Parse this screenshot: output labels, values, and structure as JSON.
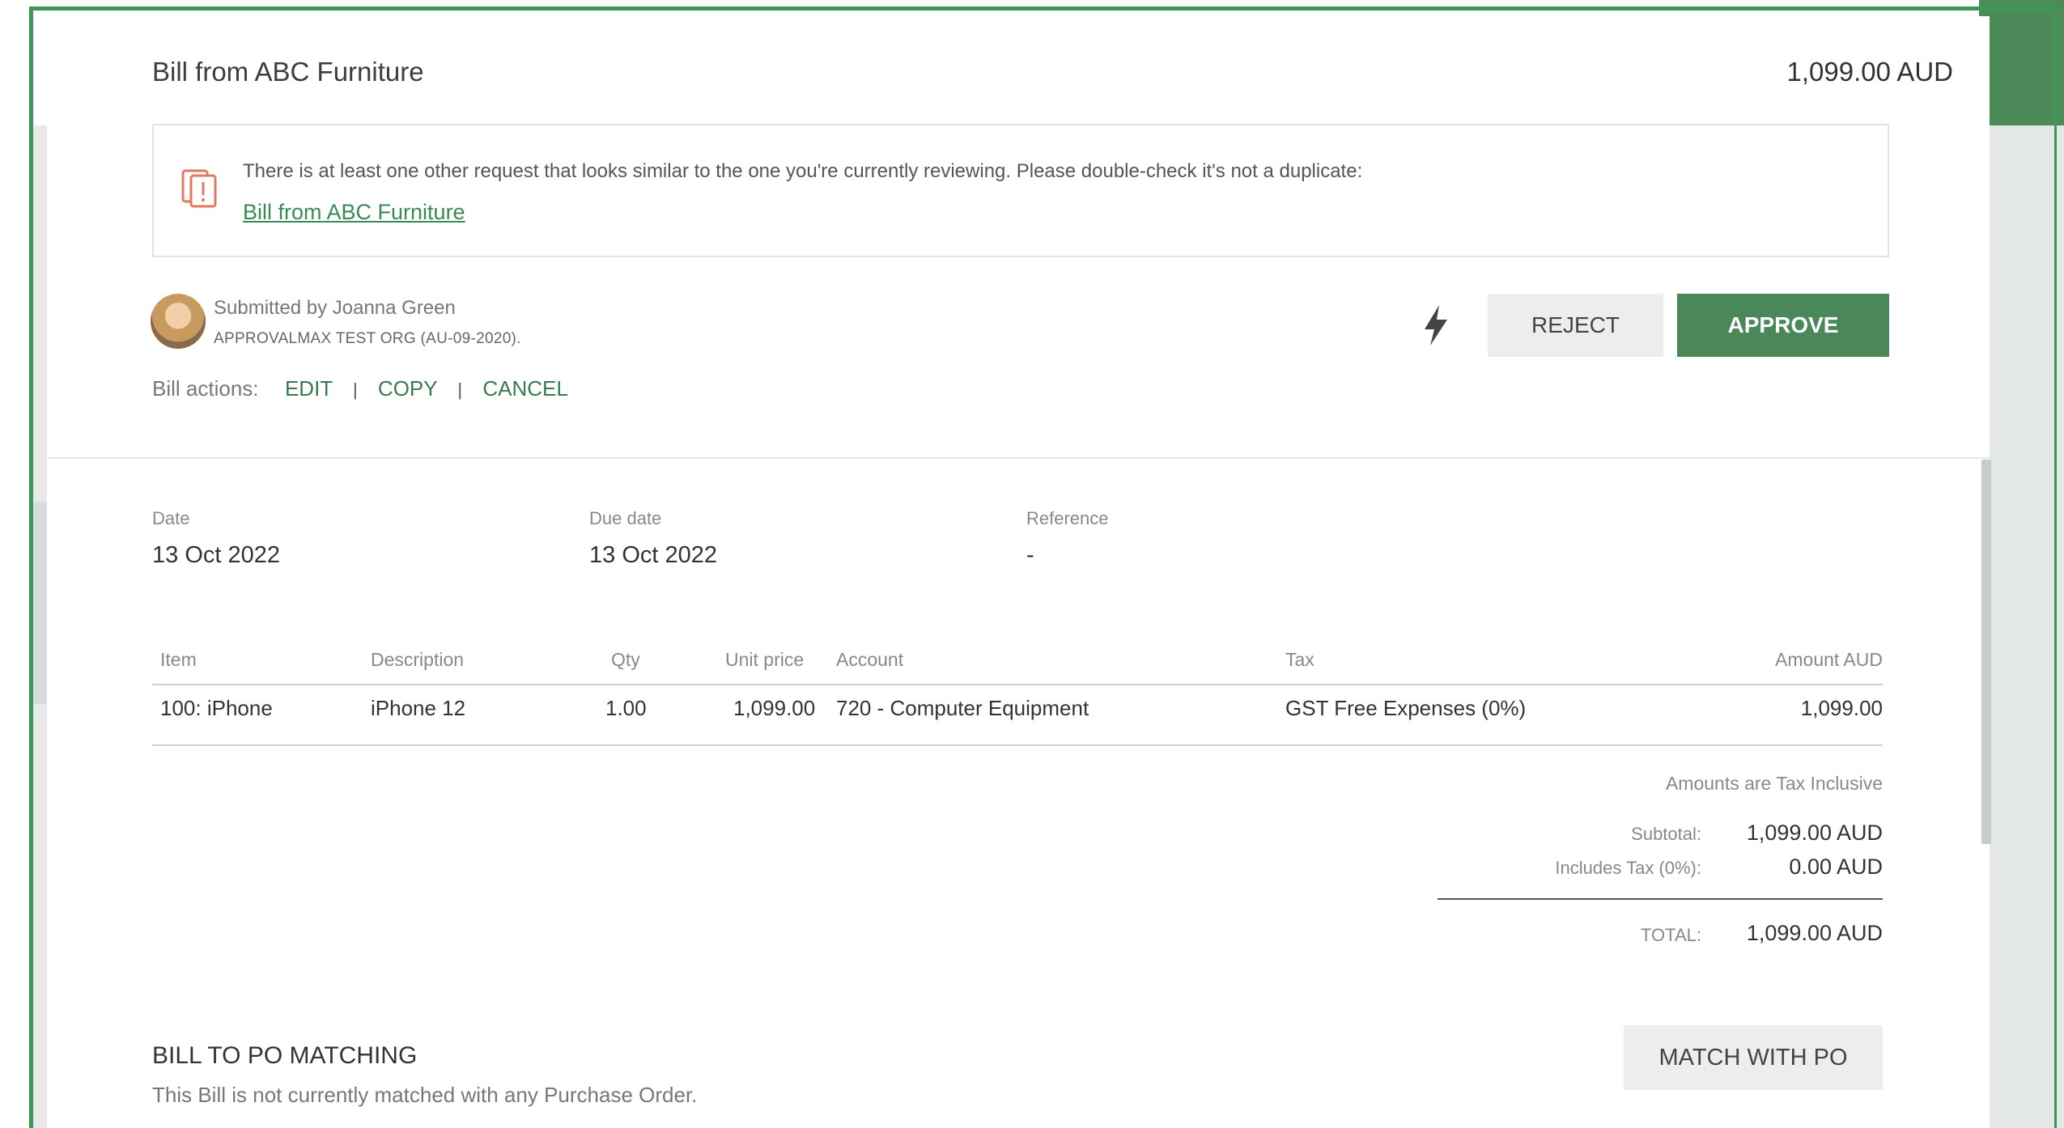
{
  "bill": {
    "title": "Bill from ABC Furniture",
    "amount": "1,099.00 AUD"
  },
  "duplicate_warning": {
    "message": "There is at least one other request that looks similar to the one you're currently reviewing. Please double-check it's not a duplicate:",
    "link": "Bill from ABC Furniture",
    "icon": "duplicate-icon",
    "icon_color": "#e07a62"
  },
  "submitter": {
    "line": "Submitted by Joanna Green",
    "org": "APPROVALMAX TEST ORG (AU-09-2020)."
  },
  "bill_actions": {
    "label": "Bill actions:",
    "edit": "EDIT",
    "copy": "COPY",
    "cancel": "CANCEL",
    "separator": "|"
  },
  "buttons": {
    "reject": "REJECT",
    "approve": "APPROVE",
    "match_po": "MATCH WITH PO",
    "bolt_icon": "lightning-icon"
  },
  "colors": {
    "accent_green": "#4a8759",
    "frame_green": "#3a9a55",
    "link_green": "#3a8a55"
  },
  "details": {
    "date_label": "Date",
    "date_value": "13 Oct 2022",
    "due_label": "Due date",
    "due_value": "13 Oct 2022",
    "ref_label": "Reference",
    "ref_value": "-"
  },
  "table": {
    "headers": {
      "item": "Item",
      "description": "Description",
      "qty": "Qty",
      "unit_price": "Unit price",
      "account": "Account",
      "tax": "Tax",
      "amount": "Amount AUD"
    },
    "rows": [
      {
        "item": "100: iPhone",
        "description": "iPhone 12",
        "qty": "1.00",
        "unit_price": "1,099.00",
        "account": "720 - Computer Equipment",
        "tax": "GST Free Expenses (0%)",
        "amount": "1,099.00"
      }
    ]
  },
  "totals": {
    "tax_note": "Amounts are Tax Inclusive",
    "subtotal_label": "Subtotal:",
    "subtotal_value": "1,099.00 AUD",
    "tax_label": "Includes Tax (0%):",
    "tax_value": "0.00 AUD",
    "total_label": "TOTAL:",
    "total_value": "1,099.00 AUD"
  },
  "po_matching": {
    "title": "BILL TO PO MATCHING",
    "text": "This Bill is not currently matched with any Purchase Order."
  }
}
